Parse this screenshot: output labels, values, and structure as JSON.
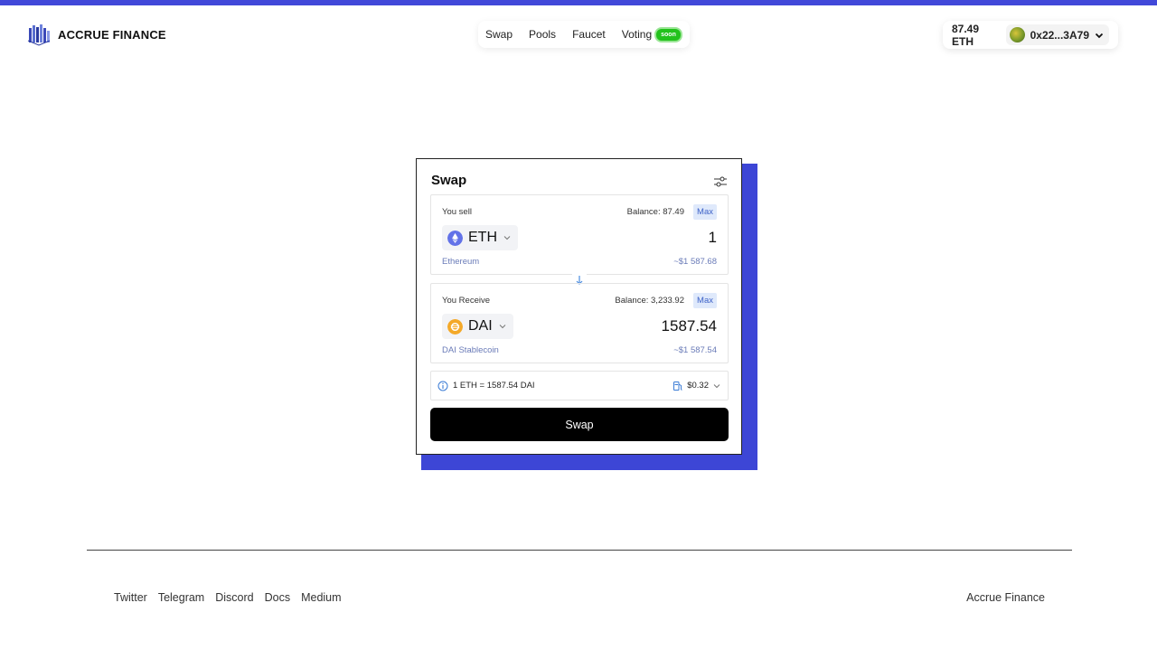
{
  "brand": {
    "name": "ACCRUE FINANCE",
    "accent": "#4148d9"
  },
  "nav": {
    "items": [
      {
        "label": "Swap"
      },
      {
        "label": "Pools"
      },
      {
        "label": "Faucet"
      },
      {
        "label": "Voting",
        "badge": "soon"
      }
    ]
  },
  "wallet": {
    "balance": "87.49 ETH",
    "address": "0x22...3A79",
    "icon": "chevron-down-icon"
  },
  "swap": {
    "title": "Swap",
    "sell": {
      "label": "You sell",
      "balance": "Balance: 87.49",
      "max": "Max",
      "token": "ETH",
      "amount": "1",
      "token_name": "Ethereum",
      "usd": "~$1 587.68"
    },
    "receive": {
      "label": "You Receive",
      "balance": "Balance: 3,233.92",
      "max": "Max",
      "token": "DAI",
      "amount": "1587.54",
      "token_name": "DAI Stablecoin",
      "usd": "~$1 587.54"
    },
    "rate": "1 ETH = 1587.54 DAI",
    "gas": "$0.32",
    "button": "Swap"
  },
  "footer": {
    "links": [
      "Twitter",
      "Telegram",
      "Discord",
      "Docs",
      "Medium"
    ],
    "right": "Accrue Finance"
  }
}
